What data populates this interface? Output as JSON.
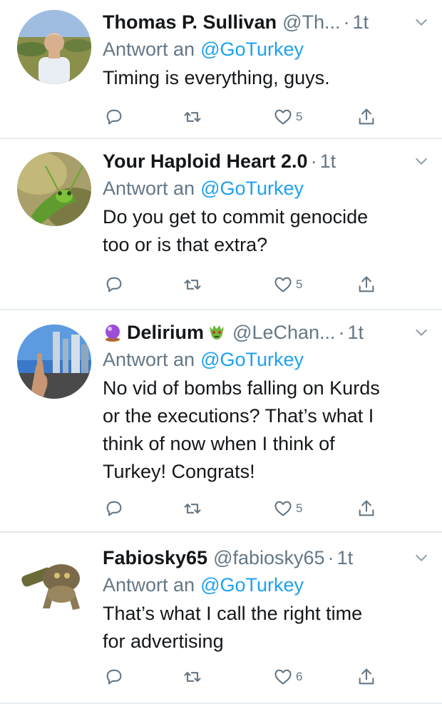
{
  "tweets": [
    {
      "name": "Thomas P. Sullivan",
      "handle": "@Th...",
      "dot": "·",
      "time": "1t",
      "reply_prefix": "Antwort an",
      "reply_mention": "@GoTurkey",
      "text_lines": [
        "Timing is everything, guys."
      ],
      "like_count": "5",
      "avatar": "avatar-thomas"
    },
    {
      "name": "Your Haploid Heart 2.0",
      "handle": "",
      "dot": "·",
      "time": "1t",
      "reply_prefix": "Antwort an",
      "reply_mention": "@GoTurkey",
      "text_lines": [
        "Do you get to commit genocide",
        "too or is that extra?"
      ],
      "like_count": "5",
      "avatar": "avatar-mantis"
    },
    {
      "name": "Delirium",
      "handle": "@LeChan...",
      "dot": "·",
      "time": "1t",
      "reply_prefix": "Antwort an",
      "reply_mention": "@GoTurkey",
      "text_lines": [
        "No vid of bombs falling on Kurds",
        "or the executions? That’s what I",
        "think of now when I think of",
        "Turkey! Congrats!"
      ],
      "like_count": "5",
      "avatar": "avatar-delirium",
      "name_prefix_icon": "crystal-ball-icon",
      "name_suffix_icon": "dragon-face-icon"
    },
    {
      "name": "Fabiosky65",
      "handle": "@fabiosky65",
      "dot": "·",
      "time": "1t",
      "reply_prefix": "Antwort an",
      "reply_mention": "@GoTurkey",
      "text_lines": [
        "That’s what I call the right time",
        "for advertising"
      ],
      "like_count": "6",
      "avatar": "avatar-fabiosky"
    }
  ],
  "icons": {
    "reply": "reply-icon",
    "retweet": "retweet-icon",
    "like": "heart-icon",
    "share": "share-icon",
    "more": "chevron-down-icon"
  },
  "colors": {
    "link": "#1da1f2",
    "secondary": "#657786",
    "divider": "#e6ecf0"
  }
}
